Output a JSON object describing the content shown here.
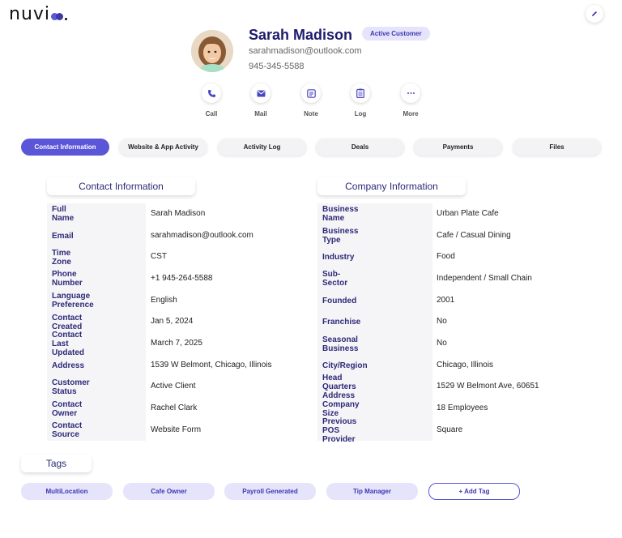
{
  "brand": {
    "name": "nuvi"
  },
  "profile": {
    "name": "Sarah Madison",
    "status_badge": "Active Customer",
    "email": "sarahmadison@outlook.com",
    "phone": "945-345-5588"
  },
  "actions": [
    {
      "label": "Call",
      "icon": "phone-icon"
    },
    {
      "label": "Mail",
      "icon": "mail-icon"
    },
    {
      "label": "Note",
      "icon": "note-icon"
    },
    {
      "label": "Log",
      "icon": "clipboard-icon"
    },
    {
      "label": "More",
      "icon": "more-icon"
    }
  ],
  "tabs": [
    {
      "label": "Contact Information",
      "active": true
    },
    {
      "label": "Website & App Activity"
    },
    {
      "label": "Activity Log"
    },
    {
      "label": "Deals"
    },
    {
      "label": "Payments"
    },
    {
      "label": "Files"
    }
  ],
  "contact": {
    "title": "Contact Information",
    "rows": [
      {
        "key": "Full Name",
        "value": "Sarah Madison"
      },
      {
        "key": "Email",
        "value": "sarahmadison@outlook.com"
      },
      {
        "key": "Time Zone",
        "value": "CST"
      },
      {
        "key": "Phone Number",
        "value": "+1 945-264-5588"
      },
      {
        "key": "Language Preference",
        "value": "English"
      },
      {
        "key": "Contact Created",
        "value": "Jan 5, 2024"
      },
      {
        "key": "Contact Last Updated",
        "value": "March 7, 2025"
      },
      {
        "key": "Address",
        "value": "1539 W Belmont, Chicago, Illinois"
      },
      {
        "key": "Customer Status",
        "value": "Active Client"
      },
      {
        "key": "Contact Owner",
        "value": "Rachel Clark"
      },
      {
        "key": "Contact Source",
        "value": "Website Form"
      }
    ]
  },
  "company": {
    "title": "Company Information",
    "rows": [
      {
        "key": "Business Name",
        "value": "Urban Plate Cafe"
      },
      {
        "key": "Business Type",
        "value": "Cafe / Casual Dining"
      },
      {
        "key": "Industry",
        "value": "Food"
      },
      {
        "key": "Sub-Sector",
        "value": "Independent / Small Chain"
      },
      {
        "key": "Founded",
        "value": "2001"
      },
      {
        "key": "Franchise",
        "value": "No"
      },
      {
        "key": "Seasonal Business",
        "value": "No"
      },
      {
        "key": "City/Region",
        "value": "Chicago, Illinois"
      },
      {
        "key": "Head Quarters Address",
        "value": "1529 W Belmont Ave, 60651"
      },
      {
        "key": "Company Size",
        "value": "18 Employees"
      },
      {
        "key": "Previous POS Provider",
        "value": "Square"
      }
    ]
  },
  "tags": {
    "title": "Tags",
    "items": [
      "MultiLocation",
      "Cafe Owner",
      "Payroll Generated",
      "Tip Manager"
    ],
    "add_label": "+ Add Tag"
  },
  "colors": {
    "accent": "#5b55d8",
    "heading": "#2d2a78",
    "badge_bg": "#e6e4fb"
  }
}
